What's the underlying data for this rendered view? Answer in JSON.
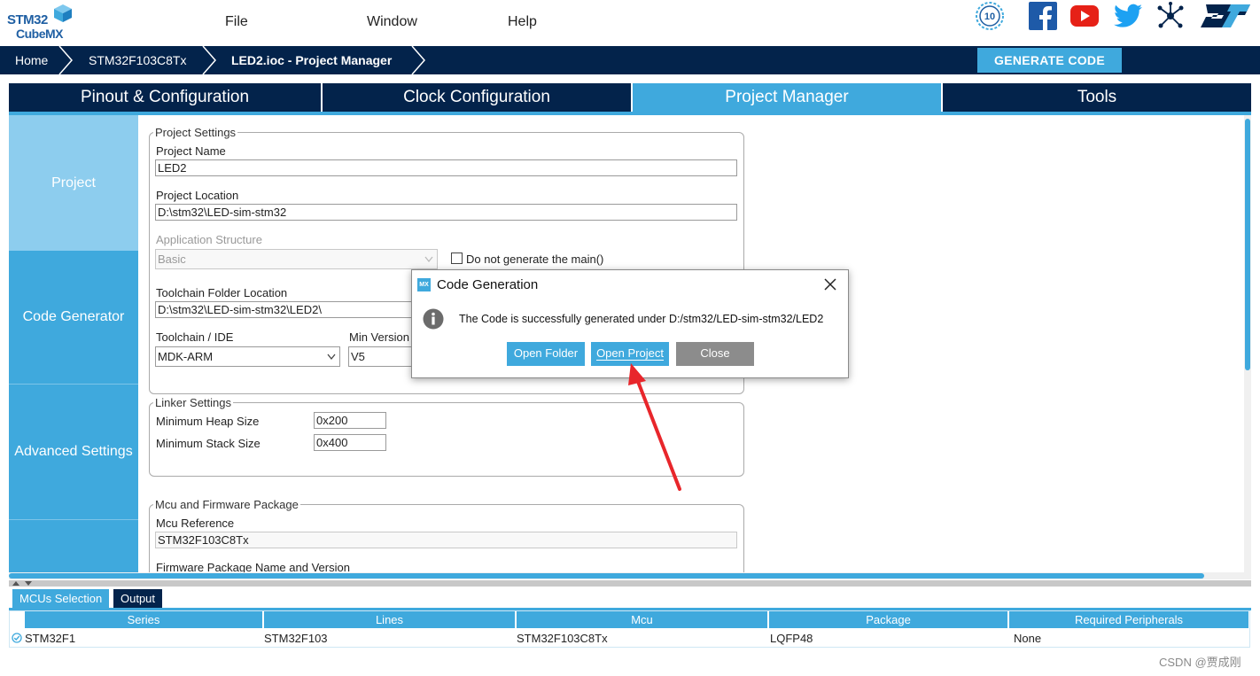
{
  "logo": {
    "line1": "STM32",
    "line2": "CubeMX"
  },
  "menu": {
    "file": "File",
    "window": "Window",
    "help": "Help"
  },
  "header_icons": [
    "anniversary-10-icon",
    "facebook-icon",
    "youtube-icon",
    "twitter-icon",
    "network-share-icon",
    "st-logo-icon"
  ],
  "anniversary_badge": "10",
  "breadcrumb": {
    "home": "Home",
    "mcu": "STM32F103C8Tx",
    "project": "LED2.ioc - Project Manager"
  },
  "generate_button": "GENERATE CODE",
  "tabs": {
    "pinout": "Pinout & Configuration",
    "clock": "Clock Configuration",
    "project_manager": "Project Manager",
    "tools": "Tools"
  },
  "sidenav": {
    "project": "Project",
    "code_generator": "Code Generator",
    "advanced": "Advanced Settings"
  },
  "project_settings": {
    "legend": "Project Settings",
    "name_label": "Project Name",
    "name_value": "LED2",
    "location_label": "Project Location",
    "location_value": "D:\\stm32\\LED-sim-stm32",
    "app_structure_label": "Application Structure",
    "app_structure_value": "Basic",
    "no_main_label": "Do not generate the main()",
    "toolchain_folder_label": "Toolchain Folder Location",
    "toolchain_folder_value": "D:\\stm32\\LED-sim-stm32\\LED2\\",
    "toolchain_label": "Toolchain / IDE",
    "toolchain_value": "MDK-ARM",
    "min_version_label": "Min Version",
    "min_version_value": "V5"
  },
  "linker_settings": {
    "legend": "Linker Settings",
    "heap_label": "Minimum Heap Size",
    "heap_value": "0x200",
    "stack_label": "Minimum Stack Size",
    "stack_value": "0x400"
  },
  "mcu_package": {
    "legend": "Mcu and Firmware Package",
    "ref_label": "Mcu Reference",
    "ref_value": "STM32F103C8Tx",
    "fw_label": "Firmware Package Name and Version"
  },
  "bottom_tabs": {
    "mcus": "MCUs Selection",
    "output": "Output"
  },
  "table": {
    "headers": [
      "Series",
      "Lines",
      "Mcu",
      "Package",
      "Required Peripherals"
    ],
    "row": [
      "STM32F1",
      "STM32F103",
      "STM32F103C8Tx",
      "LQFP48",
      "None"
    ]
  },
  "dialog": {
    "title": "Code Generation",
    "message": "The Code is successfully generated under D:/stm32/LED-sim-stm32/LED2",
    "open_folder": "Open Folder",
    "open_project": "Open Project",
    "close": "Close"
  },
  "watermark": "CSDN @贾成刚",
  "colors": {
    "navy": "#03234b",
    "accent": "#3fa9dd",
    "light_accent": "#8dcdee",
    "annotation_arrow": "#e8262b"
  }
}
